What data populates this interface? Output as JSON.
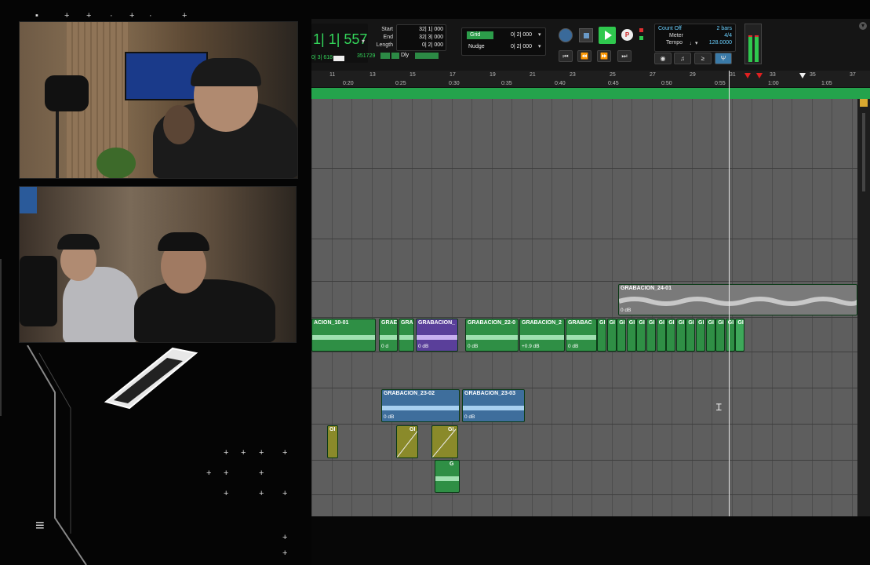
{
  "counter": {
    "main": "1| 1| 557",
    "sub": "0| 3| 618",
    "samples": "351729"
  },
  "selection": {
    "start_label": "Start",
    "end_label": "End",
    "length_label": "Length",
    "start": "32| 1| 000",
    "end": "32| 3| 000",
    "length": "0| 2| 000"
  },
  "grid": {
    "label": "Grid",
    "value": "0| 2| 000",
    "nudge_label": "Nudge",
    "nudge_value": "0| 2| 000"
  },
  "count": {
    "count_off": "Count Off",
    "bars": "2 bars",
    "meter_label": "Meter",
    "meter": "4/4",
    "tempo_label": "Tempo",
    "tempo": "128.0000"
  },
  "dly": "Dly",
  "ruler": {
    "bars": [
      "11",
      "13",
      "15",
      "17",
      "19",
      "21",
      "23",
      "25",
      "27",
      "29",
      "31",
      "33",
      "35",
      "37"
    ],
    "times": [
      "0:20",
      "0:25",
      "0:30",
      "0:35",
      "0:40",
      "0:45",
      "0:50",
      "0:55",
      "1:00",
      "1:05"
    ]
  },
  "clips": {
    "c24": {
      "name": "GRABACION_24-01",
      "gain": "0 dB"
    },
    "c10": {
      "name": "ACION_10-01"
    },
    "cgrae": {
      "name": "GRAE",
      "gain": "0 d"
    },
    "cgra": {
      "name": "GRA"
    },
    "cgrabp": {
      "name": "GRABACION_",
      "gain": "0 dB"
    },
    "c22": {
      "name": "GRABACION_22-0",
      "gain": "0 dB"
    },
    "c2": {
      "name": "GRABACION_2",
      "gain": "+0.9 dB"
    },
    "cgrabac": {
      "name": "GRABAC",
      "gain": "0 dB"
    },
    "cgi": {
      "name": "GI"
    },
    "c2302": {
      "name": "GRABACION_23-02",
      "gain": "0 dB"
    },
    "c2303": {
      "name": "GRABACION_23-03",
      "gain": "0 dB"
    },
    "cg": {
      "name": "G"
    }
  },
  "colors": {
    "green": "#2f8f45",
    "purple": "#5a3f9a",
    "blue": "#3e6e9c",
    "yellow": "#8a8a2a",
    "marker": "#24a34c"
  }
}
